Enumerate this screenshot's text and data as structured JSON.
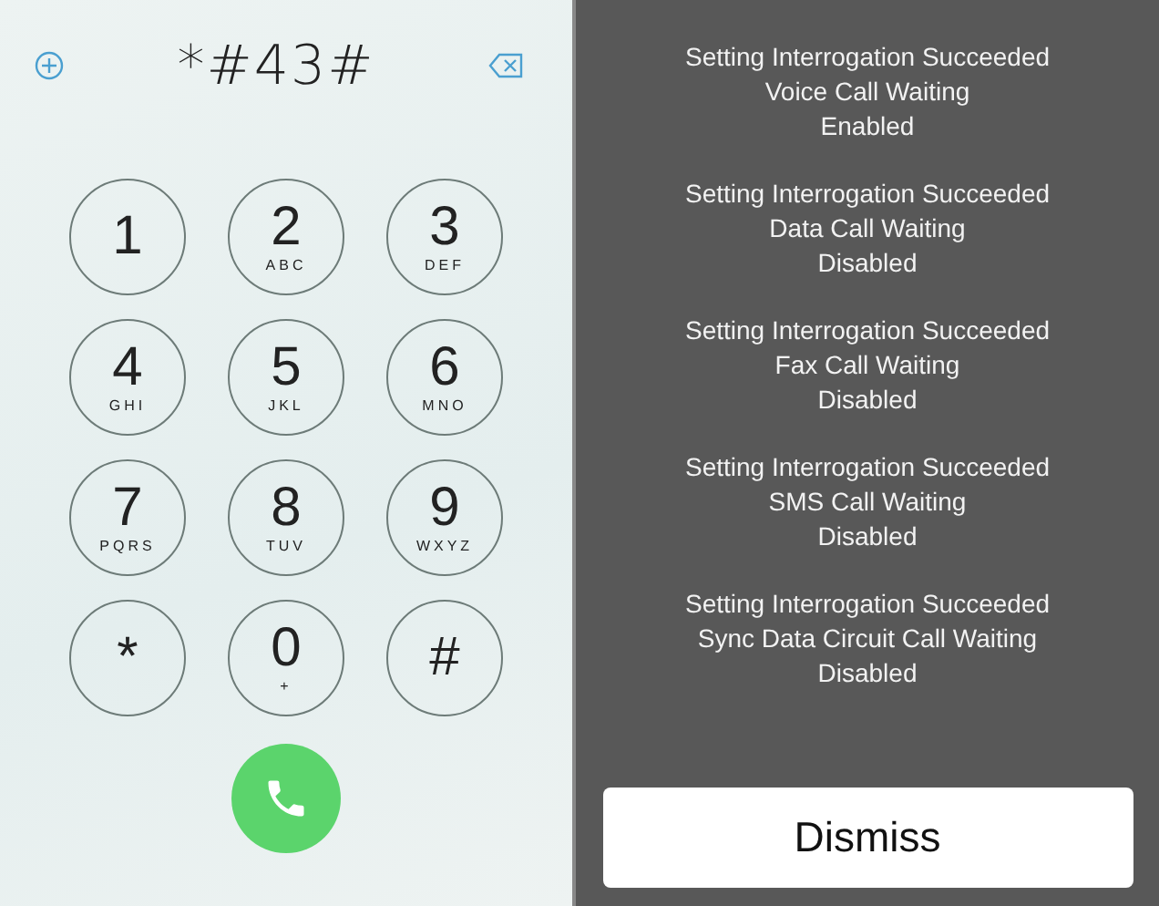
{
  "dialer": {
    "number": "*#43#",
    "keys": [
      {
        "digit": "1"
      },
      {
        "digit": "2",
        "letters": "ABC"
      },
      {
        "digit": "3",
        "letters": "DEF"
      },
      {
        "digit": "4",
        "letters": "GHI"
      },
      {
        "digit": "5",
        "letters": "JKL"
      },
      {
        "digit": "6",
        "letters": "MNO"
      },
      {
        "digit": "7",
        "letters": "PQRS"
      },
      {
        "digit": "8",
        "letters": "TUV"
      },
      {
        "digit": "9",
        "letters": "WXYZ"
      },
      {
        "digit": "*"
      },
      {
        "digit": "0",
        "letters": "+"
      },
      {
        "digit": "#"
      }
    ]
  },
  "alert": {
    "messages": [
      {
        "title": "Setting Interrogation Succeeded",
        "service": "Voice Call Waiting",
        "status": "Enabled"
      },
      {
        "title": "Setting Interrogation Succeeded",
        "service": "Data Call Waiting",
        "status": "Disabled"
      },
      {
        "title": "Setting Interrogation Succeeded",
        "service": "Fax Call Waiting",
        "status": "Disabled"
      },
      {
        "title": "Setting Interrogation Succeeded",
        "service": "SMS Call Waiting",
        "status": "Disabled"
      },
      {
        "title": "Setting Interrogation Succeeded",
        "service": "Sync Data Circuit Call Waiting",
        "status": "Disabled"
      }
    ],
    "button": "Dismiss"
  }
}
